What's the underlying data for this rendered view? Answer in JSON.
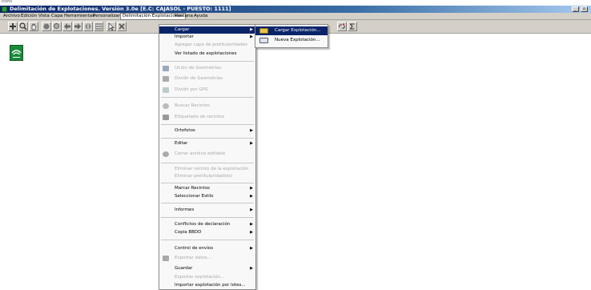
{
  "top_strip_text": "icons",
  "window": {
    "title": "Delimitación de Explotaciones. Versión 3.0e   [E.C: CAJASOL - PUESTO: 1111]",
    "minimize_label": "_",
    "restore_label": "▫"
  },
  "menubar": {
    "items": [
      "Archivo",
      "Edición",
      "Vista",
      "Capa",
      "Herramientas",
      "Personalizar",
      "Delimitación Explotaciones",
      "Ventana",
      "Ayuda"
    ]
  },
  "main_menu": {
    "items": [
      {
        "label": "Cargar",
        "arrow": "▶"
      },
      {
        "label": "Importar",
        "arrow": "▶"
      },
      {
        "label": "Agregar capa de pretitularidades"
      },
      {
        "label": "Ver listado de explotaciones"
      },
      {
        "label": "Unión de Geometrías"
      },
      {
        "label": "Dividir de Geometrías"
      },
      {
        "label": "Dividir por GPS"
      },
      {
        "label": "Buscar Recintos"
      },
      {
        "label": "Etiquetado de recintos"
      },
      {
        "label": "Ortofotos",
        "arrow": "▶"
      },
      {
        "label": "Editar",
        "arrow": "▶"
      },
      {
        "label": "Cerrar archivo editable"
      },
      {
        "label": "Eliminar recinto de la explotación"
      },
      {
        "label": "Eliminar pretitularidad(es)"
      },
      {
        "label": "Marcar Recintos",
        "arrow": "▶"
      },
      {
        "label": "Seleccionar Estilo",
        "arrow": "▶"
      },
      {
        "label": "Informes",
        "arrow": "▶"
      },
      {
        "label": "Conflictos de declaración",
        "arrow": "▶"
      },
      {
        "label": "Copia BBDD",
        "arrow": "▶"
      },
      {
        "label": "Control de envíos",
        "arrow": "▶"
      },
      {
        "label": "Exportar datos..."
      },
      {
        "label": "Guardar",
        "arrow": "▶"
      },
      {
        "label": "Exportar explotación..."
      },
      {
        "label": "Importar explotación por lotes..."
      }
    ]
  },
  "sub_menu": {
    "items": [
      {
        "label": "Cargar Explotación..."
      },
      {
        "label": "Nueva Explotación..."
      }
    ]
  },
  "colors": {
    "menu_highlight": "#0a246a",
    "logo_green": "#1a8a3a"
  }
}
